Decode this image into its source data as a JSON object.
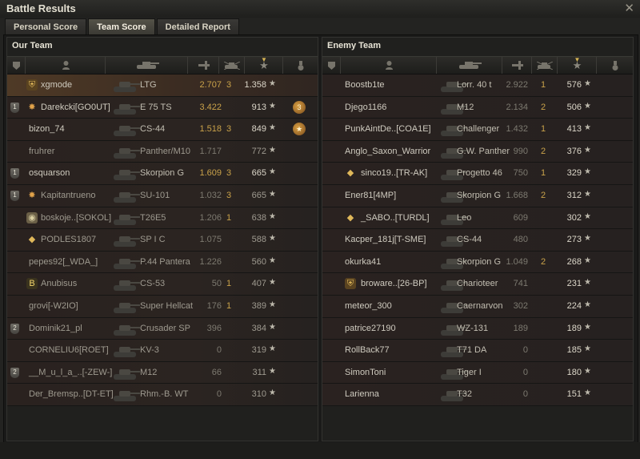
{
  "window": {
    "title": "Battle Results",
    "close_glyph": "✕"
  },
  "tabs": [
    {
      "label": "Personal Score",
      "active": false
    },
    {
      "label": "Team Score",
      "active": true
    },
    {
      "label": "Detailed Report",
      "active": false
    }
  ],
  "our_team": {
    "title": "Our Team",
    "rows": [
      {
        "player": "xgmode",
        "clan_icon": "shield-icon",
        "vehicle": "LTG",
        "damage": "2.707",
        "kills": "3",
        "xp": "1.358",
        "me": true,
        "dim": false,
        "medal": ""
      },
      {
        "player": "Darekcki[GO0UT]",
        "platoon": "1",
        "clan_icon": "star-emblem-icon",
        "vehicle": "E 75 TS",
        "damage": "3.422",
        "kills": "",
        "xp": "913",
        "me": false,
        "dim": false,
        "medal": "3"
      },
      {
        "player": "bizon_74",
        "vehicle": "CS-44",
        "damage": "1.518",
        "kills": "3",
        "xp": "849",
        "me": false,
        "dim": false,
        "medal": "★"
      },
      {
        "player": "fruhrer",
        "vehicle": "Panther/M10",
        "damage": "1.717",
        "kills": "",
        "xp": "772",
        "me": false,
        "dim": true,
        "medal": ""
      },
      {
        "player": "osquarson",
        "platoon": "1",
        "vehicle": "Skorpion G",
        "damage": "1.609",
        "kills": "3",
        "xp": "665",
        "me": false,
        "dim": false,
        "medal": ""
      },
      {
        "player": "Kapitantrueno",
        "platoon": "1",
        "clan_icon": "star-emblem-icon",
        "vehicle": "SU-101",
        "damage": "1.032",
        "kills": "3",
        "xp": "665",
        "me": false,
        "dim": true,
        "medal": ""
      },
      {
        "player": "boskoje..[SOKOL]",
        "clan_icon": "clan-emblem-icon",
        "vehicle": "T26E5",
        "damage": "1.206",
        "kills": "1",
        "xp": "638",
        "me": false,
        "dim": true,
        "medal": ""
      },
      {
        "player": "PODLES1807",
        "clan_icon": "diamond-emblem-icon",
        "vehicle": "SP I C",
        "damage": "1.075",
        "kills": "",
        "xp": "588",
        "me": false,
        "dim": true,
        "medal": ""
      },
      {
        "player": "pepes92[_WDA_]",
        "vehicle": "P.44 Pantera",
        "damage": "1.226",
        "kills": "",
        "xp": "560",
        "me": false,
        "dim": true,
        "medal": ""
      },
      {
        "player": "Anubisus",
        "clan_icon": "b-emblem-icon",
        "vehicle": "CS-53",
        "damage": "50",
        "kills": "1",
        "xp": "407",
        "me": false,
        "dim": true,
        "medal": ""
      },
      {
        "player": "grovi[-W2IO]",
        "vehicle": "Super Hellcat",
        "damage": "176",
        "kills": "1",
        "xp": "389",
        "me": false,
        "dim": true,
        "medal": ""
      },
      {
        "player": "Dominik21_pl",
        "platoon": "2",
        "vehicle": "Crusader SP",
        "damage": "396",
        "kills": "",
        "xp": "384",
        "me": false,
        "dim": true,
        "medal": ""
      },
      {
        "player": "CORNELIU6[ROET]",
        "vehicle": "KV-3",
        "damage": "0",
        "kills": "",
        "xp": "319",
        "me": false,
        "dim": true,
        "medal": ""
      },
      {
        "player": "__M_u_l_a_..[-ZEW-]",
        "platoon": "2",
        "vehicle": "M12",
        "damage": "66",
        "kills": "",
        "xp": "311",
        "me": false,
        "dim": true,
        "medal": ""
      },
      {
        "player": "Der_Bremsp..[DT-ET]",
        "vehicle": "Rhm.-B. WT",
        "damage": "0",
        "kills": "",
        "xp": "310",
        "me": false,
        "dim": true,
        "medal": ""
      }
    ]
  },
  "enemy_team": {
    "title": "Enemy Team",
    "rows": [
      {
        "player": "Boostb1te",
        "vehicle": "Lorr. 40 t",
        "damage": "2.922",
        "kills": "1",
        "xp": "576"
      },
      {
        "player": "Djego1166",
        "vehicle": "M12",
        "damage": "2.134",
        "kills": "2",
        "xp": "506"
      },
      {
        "player": "PunkAintDe..[COA1E]",
        "vehicle": "Challenger",
        "damage": "1.432",
        "kills": "1",
        "xp": "413"
      },
      {
        "player": "Anglo_Saxon_Warrior",
        "vehicle": "G.W. Panther",
        "damage": "990",
        "kills": "2",
        "xp": "376"
      },
      {
        "player": "sinco19..[TR-AK]",
        "clan_icon": "diamond-emblem-icon",
        "vehicle": "Progetto 46",
        "damage": "750",
        "kills": "1",
        "xp": "329"
      },
      {
        "player": "Ener81[4MP]",
        "vehicle": "Skorpion G",
        "damage": "1.668",
        "kills": "2",
        "xp": "312"
      },
      {
        "player": "_SABO..[TURDL]",
        "clan_icon": "diamond-emblem-icon",
        "vehicle": "Leo",
        "damage": "609",
        "kills": "",
        "xp": "302"
      },
      {
        "player": "Kacper_181j[T-SME]",
        "vehicle": "CS-44",
        "damage": "480",
        "kills": "",
        "xp": "273"
      },
      {
        "player": "okurka41",
        "vehicle": "Skorpion G",
        "damage": "1.049",
        "kills": "2",
        "xp": "268"
      },
      {
        "player": "browarе..[26-BP]",
        "clan_icon": "shield-icon",
        "vehicle": "Charioteer",
        "damage": "741",
        "kills": "",
        "xp": "231"
      },
      {
        "player": "meteor_300",
        "vehicle": "Caernarvon",
        "damage": "302",
        "kills": "",
        "xp": "224"
      },
      {
        "player": "patrice27190",
        "vehicle": "WZ-131",
        "damage": "189",
        "kills": "",
        "xp": "189"
      },
      {
        "player": "RollBack77",
        "vehicle": "T71 DA",
        "damage": "0",
        "kills": "",
        "xp": "185"
      },
      {
        "player": "SimonToni",
        "vehicle": "Tiger I",
        "damage": "0",
        "kills": "",
        "xp": "180"
      },
      {
        "player": "Larienna",
        "vehicle": "T32",
        "damage": "0",
        "kills": "",
        "xp": "151"
      }
    ]
  },
  "header_icons": [
    "platoon-col-icon",
    "player-col-icon",
    "vehicle-col-icon",
    "damage-col-icon",
    "kills-col-icon",
    "xp-col-icon",
    "medal-col-icon"
  ],
  "star_glyph": "★",
  "colors": {
    "accent": "#c9a24a",
    "highlight_row": "#4f3a26"
  }
}
